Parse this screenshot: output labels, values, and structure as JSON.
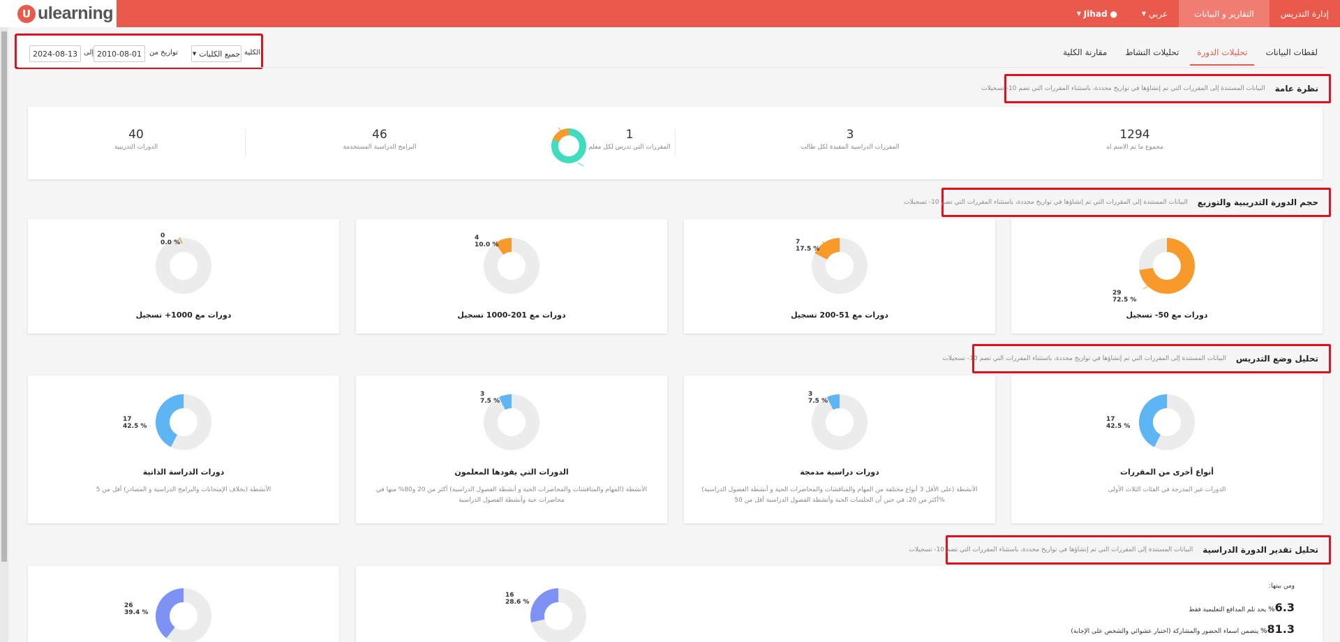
{
  "brand": {
    "logo_letter": "U",
    "name": "ulearning",
    "accent": "#ea5a4c"
  },
  "nav": {
    "items": [
      {
        "label": "إدارة التدريس"
      },
      {
        "label": "التقارير و البيانات"
      },
      {
        "label": "عربي"
      },
      {
        "label": "Jihad"
      }
    ]
  },
  "tabs": [
    {
      "label": "لقطات البيانات"
    },
    {
      "label": "تحليلات الدورة"
    },
    {
      "label": "تحليلات النشاط"
    },
    {
      "label": "مقارنة الكلية"
    }
  ],
  "filter": {
    "college_label": "الكلية",
    "college_value": "جميع الكليات",
    "date_from_label": "تواريخ من",
    "date_from": "2010-08-01",
    "date_to_label": "إلى",
    "date_to": "2024-08-13"
  },
  "section_desc": "البيانات المستندة إلى المقررات التي تم إنشاؤها في تواريخ محددة، باستثناء المقررات التي تضم 10- تسجيلات",
  "overview": {
    "title": "نظرة عامة",
    "stats": [
      {
        "value": "1294",
        "label": "مجموع ما تم الاسم له"
      },
      {
        "value": "3",
        "label": "المقررات الدراسية المقيدة لكل طالب"
      },
      {
        "value": "1",
        "label": "المقررات التي تدرس لكل معلم"
      },
      {
        "value": "46",
        "label": "البرامج الدراسية المستخدمة"
      },
      {
        "value": "40",
        "label": "الدورات التدريبية"
      }
    ]
  },
  "size_section": {
    "title": "حجم الدورة التدريبية والتوزيع",
    "cards": [
      {
        "title": "دورات مع 50- تسجيل",
        "count": "29",
        "percent": "72.5 %"
      },
      {
        "title": "دورات مع 51-200 تسجيل",
        "count": "7",
        "percent": "17.5 %"
      },
      {
        "title": "دورات مع 201-1000 تسجيل",
        "count": "4",
        "percent": "10.0 %"
      },
      {
        "title": "دورات مع 1000+ تسجيل",
        "count": "0",
        "percent": "0.0 %"
      }
    ]
  },
  "mode_section": {
    "title": "تحليل وضع التدريس",
    "cards": [
      {
        "title": "أنواع أخرى من المقررات",
        "count": "17",
        "percent": "42.5 %",
        "desc": "الدورات غير المدرجة في الفئات الثلاث الأولى"
      },
      {
        "title": "دورات دراسية مدمجة",
        "count": "3",
        "percent": "7.5 %",
        "desc": "الأنشطة (على الأقل 3 أنواع مختلفة من المهام والمناقشات والمحاضرات الحية و أنشطة الفصول الدراسية) أكثر من 20، في حين أن الجلسات الحية وأنشطة الفصول الدراسية أقل من 50%"
      },
      {
        "title": "الدورات التي يقودها المعلمون",
        "count": "3",
        "percent": "7.5 %",
        "desc": "الأنشطة (المهام والمناقشات والمحاضرات الحية و أنشطة الفصول الدراسية) أكثر من 20 و80% منها في محاضرات حية وأنشطة الفصول الدراسية"
      },
      {
        "title": "دورات الدراسة الذاتية",
        "count": "17",
        "percent": "42.5 %",
        "desc": "الأنشطة (بخلاف الإمتحانات والبرامج الدراسية و المصادر) أقل من 5"
      }
    ]
  },
  "rating_section": {
    "title": "تحليل تقدير الدورة الدراسية",
    "intro": "ومن بينها:",
    "lines": [
      {
        "value": "6.3",
        "text": "يحد تلم المدافع التعليمية فقط"
      },
      {
        "value": "81.3",
        "text": "يتضمن اسماء الحضور والمشاركة (اختبار عشوائي والشخص على الإجابة)"
      }
    ],
    "donuts": [
      {
        "count": "16",
        "percent": "28.6 %"
      },
      {
        "count": "26",
        "percent": "39.4 %"
      }
    ]
  },
  "colors": {
    "orange": "#f79a2a",
    "teal": "#3fdcc0",
    "blue": "#5db5f3",
    "indigo": "#7e92f6",
    "ring_bg": "#ececec"
  },
  "icons": {
    "user": "user-icon",
    "caret": "caret-down-icon"
  }
}
